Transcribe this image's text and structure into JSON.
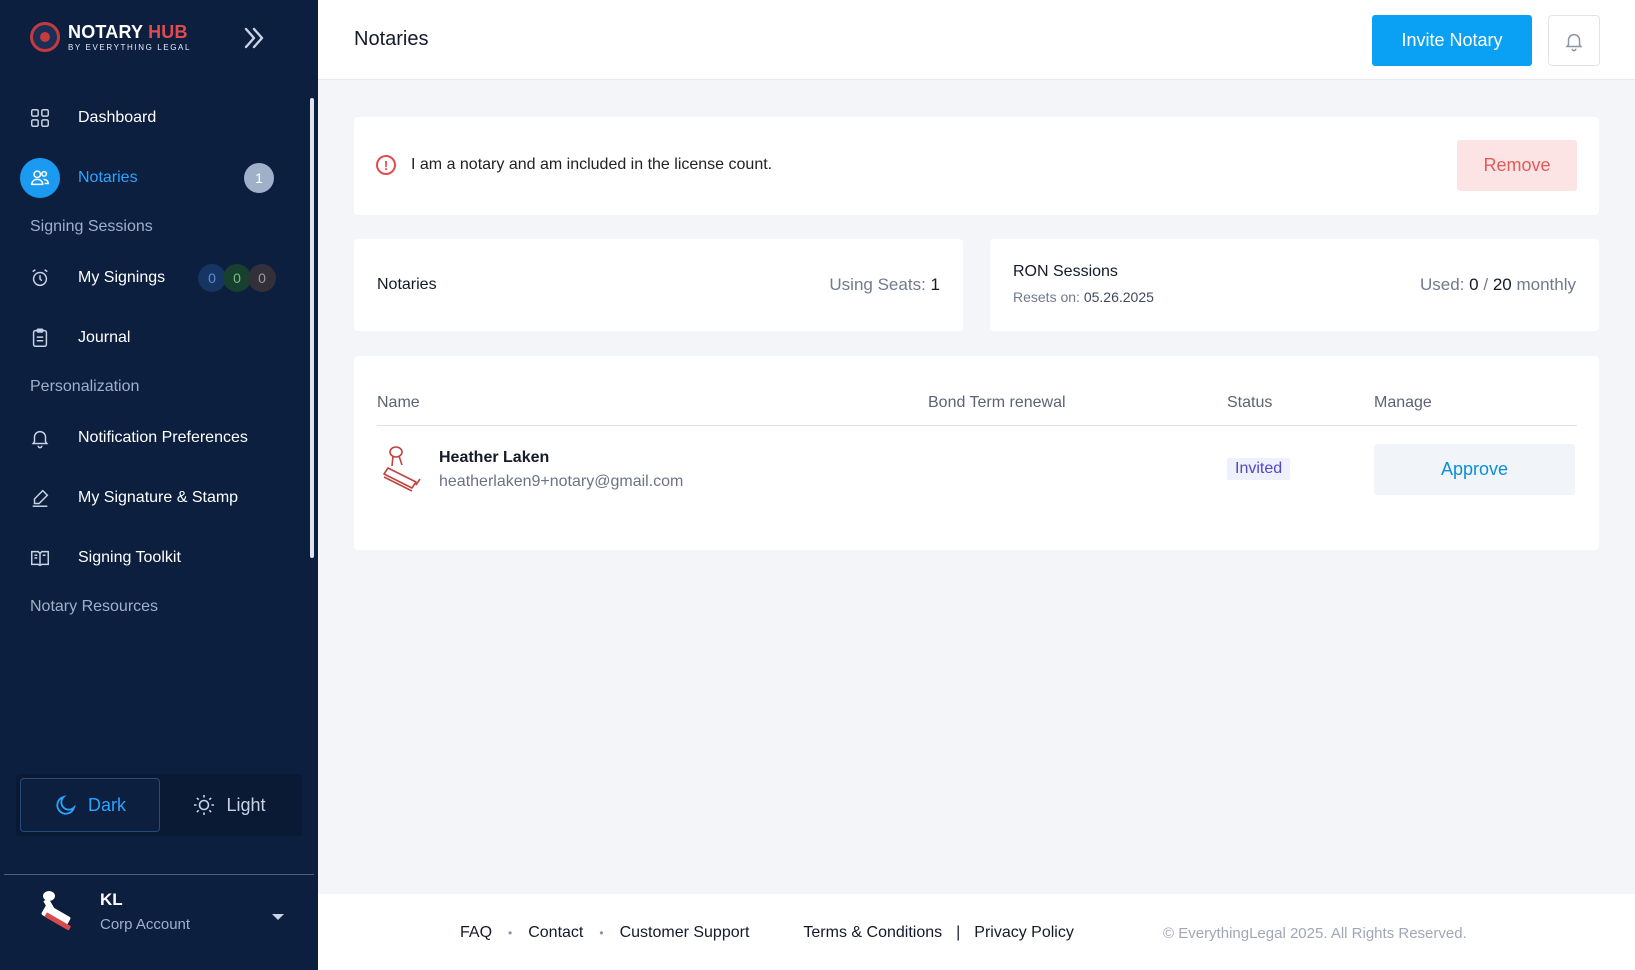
{
  "brand": {
    "name_part1": "NOTARY",
    "name_part2": "HUB",
    "subtitle": "BY EVERYTHING LEGAL"
  },
  "sidebar": {
    "dashboard": "Dashboard",
    "notaries": "Notaries",
    "notaries_badge": "1",
    "section_signing": "Signing Sessions",
    "my_signings": "My Signings",
    "signing_counts": [
      "0",
      "0",
      "0"
    ],
    "journal": "Journal",
    "section_personalization": "Personalization",
    "notification_prefs": "Notification Preferences",
    "signature_stamp": "My Signature & Stamp",
    "signing_toolkit": "Signing Toolkit",
    "section_resources": "Notary Resources"
  },
  "theme": {
    "dark": "Dark",
    "light": "Light",
    "selected": "Dark"
  },
  "user": {
    "initials": "KL",
    "role": "Corp Account"
  },
  "header": {
    "title": "Notaries",
    "invite_label": "Invite Notary"
  },
  "alert": {
    "text": "I am a notary and am included in the license count.",
    "remove_label": "Remove"
  },
  "stats": {
    "notaries_title": "Notaries",
    "seats_label": "Using Seats:",
    "seats_value": "1",
    "ron_title": "RON Sessions",
    "resets_label": "Resets on:",
    "resets_date": "05.26.2025",
    "used_label": "Used:",
    "used_value": "0",
    "used_sep": "/",
    "used_limit": "20",
    "used_period": "monthly"
  },
  "table": {
    "headers": [
      "Name",
      "Bond Term renewal",
      "Status",
      "Manage"
    ],
    "rows": [
      {
        "name": "Heather Laken",
        "email": "heatherlaken9+notary@gmail.com",
        "bond_term": "",
        "status": "Invited",
        "action": "Approve"
      }
    ]
  },
  "footer": {
    "faq": "FAQ",
    "contact": "Contact",
    "support": "Customer Support",
    "terms": "Terms & Conditions",
    "privacy": "Privacy Policy",
    "copyright": "© EverythingLegal 2025. All Rights Reserved."
  },
  "colors": {
    "sidebar_bg": "#0c1f3f",
    "accent": "#0aa1f5",
    "danger": "#e35a5a"
  }
}
